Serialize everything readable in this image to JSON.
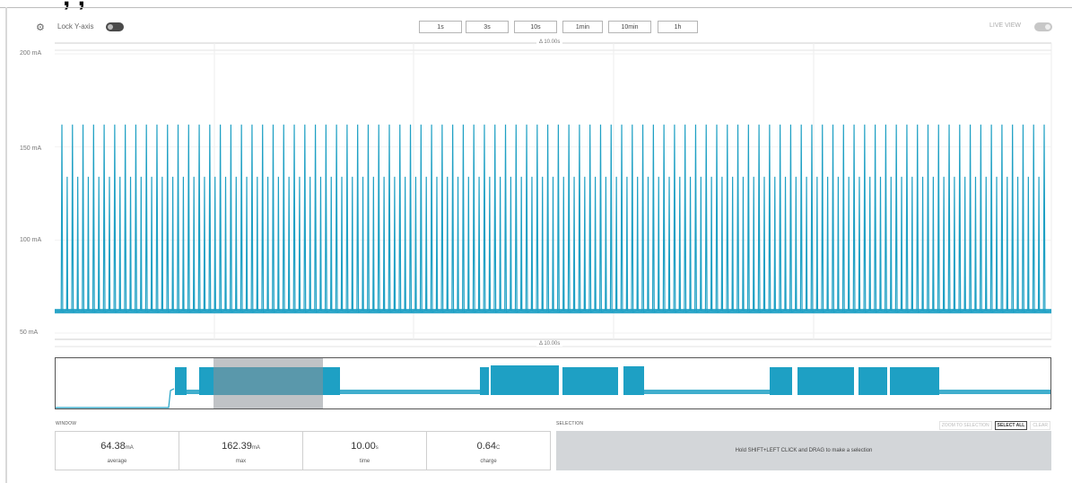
{
  "toolbar": {
    "lock_label": "Lock Y-axis",
    "zoom_buttons": [
      "1s",
      "3s",
      "10s",
      "1min",
      "10min",
      "1h"
    ],
    "live_label": "LIVE VIEW"
  },
  "chart": {
    "span_label": "Δ 10.00s",
    "y_ticks": [
      "200 mA",
      "150 mA",
      "100 mA",
      "50 mA"
    ],
    "trace_color": "#1ea0c4",
    "selection_color": "#8c9297"
  },
  "chart_data": {
    "type": "line",
    "title": "",
    "xlabel": "",
    "ylabel": "",
    "y_unit": "mA",
    "ylim": [
      40,
      205
    ],
    "x_span_s": 10.0,
    "baseline_mA": 62,
    "peak_mA": 162,
    "pulse_count": 94,
    "grid": true
  },
  "window": {
    "title": "WINDOW",
    "stats": [
      {
        "value": "64.38",
        "unit": "mA",
        "label": "average"
      },
      {
        "value": "162.39",
        "unit": "mA",
        "label": "max"
      },
      {
        "value": "10.00",
        "unit": "s",
        "label": "time"
      },
      {
        "value": "0.64",
        "unit": "C",
        "label": "charge"
      }
    ]
  },
  "selection": {
    "title": "SELECTION",
    "actions": [
      "ZOOM TO SELECTION",
      "SELECT ALL",
      "CLEAR"
    ],
    "message": "Hold SHIFT+LEFT CLICK and DRAG to make a selection"
  }
}
